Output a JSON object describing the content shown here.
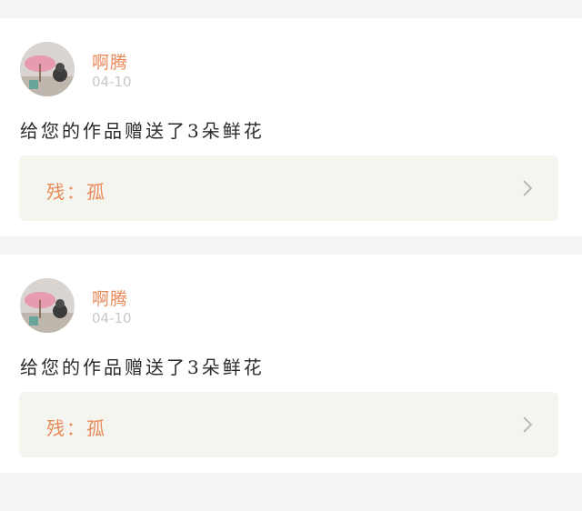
{
  "feed": {
    "items": [
      {
        "user_name": "啊腾",
        "date": "04-10",
        "message": "给您的作品赠送了3朵鲜花",
        "work_label": "残：孤"
      },
      {
        "user_name": "啊腾",
        "date": "04-10",
        "message": "给您的作品赠送了3朵鲜花",
        "work_label": "残：孤"
      }
    ]
  },
  "icons": {
    "chevron": "chevron-right-icon"
  },
  "colors": {
    "accent": "#e8895a",
    "date_text": "#c8c8c8",
    "work_bg": "#f5f5ef",
    "separator_bg": "#f6f4f4"
  }
}
